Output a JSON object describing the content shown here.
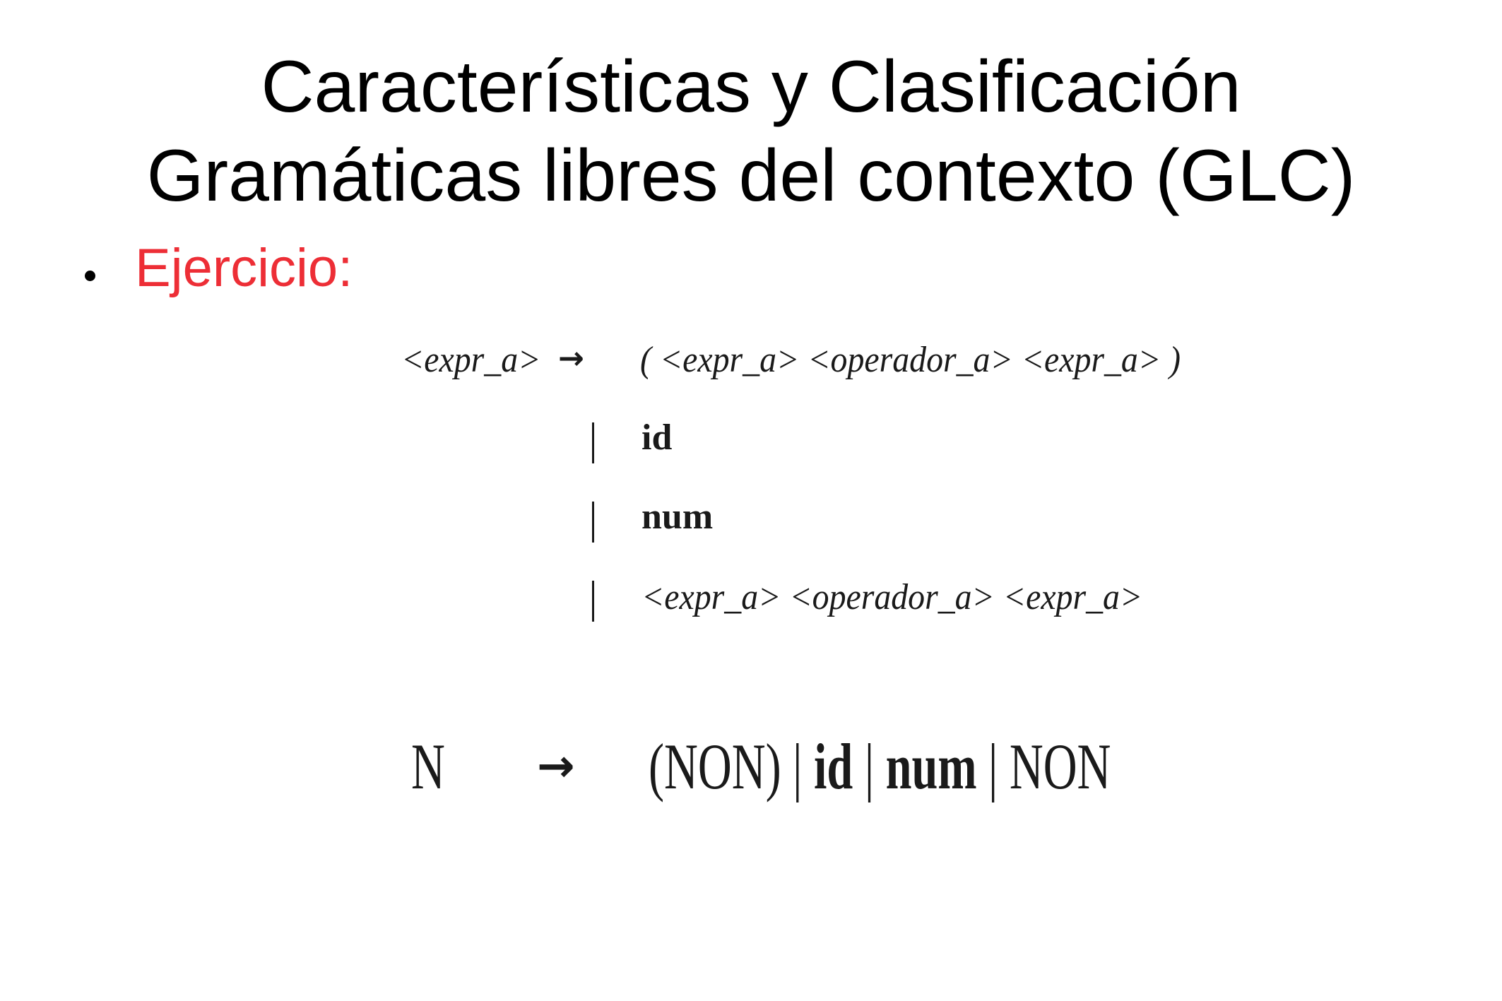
{
  "slide": {
    "title_line1": "Características y Clasificación",
    "title_line2": "Gramáticas libres del contexto (GLC)",
    "bullet": "Ejercicio:",
    "bullet_color": "#ed2e36"
  },
  "grammar": {
    "lhs": "<expr_a>",
    "arrow": "→",
    "rhs_first": "( <expr_a> <operador_a> <expr_a> )",
    "alternatives": [
      {
        "bar": "|",
        "text": "id"
      },
      {
        "bar": "|",
        "text": "num"
      },
      {
        "bar": "|",
        "text": "<expr_a> <operador_a> <expr_a>"
      }
    ]
  },
  "compact_rule": {
    "lhs": "N",
    "arrow": "→",
    "part1": "(NON) | ",
    "part2": "id",
    "part3": " | ",
    "part4": "num",
    "part5": " | NON"
  }
}
